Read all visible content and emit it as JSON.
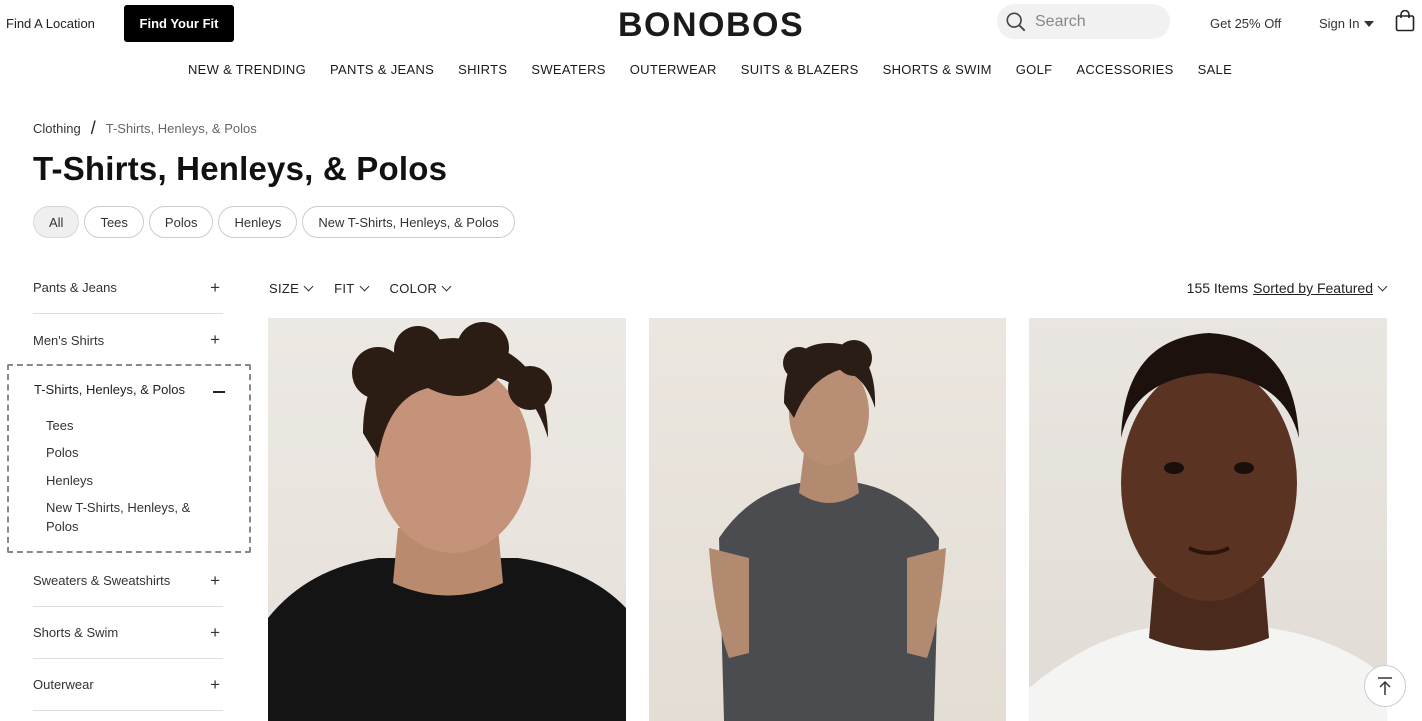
{
  "header": {
    "find_location": "Find A Location",
    "find_fit": "Find Your Fit",
    "logo": "BONOBOS",
    "search_placeholder": "Search",
    "promo": "Get 25% Off",
    "sign_in": "Sign In"
  },
  "nav": [
    "NEW & TRENDING",
    "PANTS & JEANS",
    "SHIRTS",
    "SWEATERS",
    "OUTERWEAR",
    "SUITS & BLAZERS",
    "SHORTS & SWIM",
    "GOLF",
    "ACCESSORIES",
    "SALE"
  ],
  "breadcrumb": {
    "parent": "Clothing",
    "separator": "/",
    "current": "T-Shirts, Henleys, & Polos"
  },
  "page_title": "T-Shirts, Henleys, & Polos",
  "chips": [
    {
      "label": "All",
      "active": true
    },
    {
      "label": "Tees"
    },
    {
      "label": "Polos"
    },
    {
      "label": "Henleys"
    },
    {
      "label": "New T-Shirts, Henleys, & Polos"
    }
  ],
  "sidebar": {
    "top_categories": [
      "Pants & Jeans",
      "Men's Shirts"
    ],
    "expanded": {
      "label": "T-Shirts, Henleys, & Polos",
      "items": [
        "Tees",
        "Polos",
        "Henleys",
        "New T-Shirts, Henleys, &\nPolos"
      ]
    },
    "bottom_categories": [
      "Sweaters & Sweatshirts",
      "Shorts & Swim",
      "Outerwear"
    ]
  },
  "filters": [
    "SIZE",
    "FIT",
    "COLOR"
  ],
  "sort": {
    "count": "155 Items",
    "label": "Sorted by Featured"
  },
  "colors": {
    "accent": "#000000",
    "chip_active_bg": "#efefef"
  }
}
